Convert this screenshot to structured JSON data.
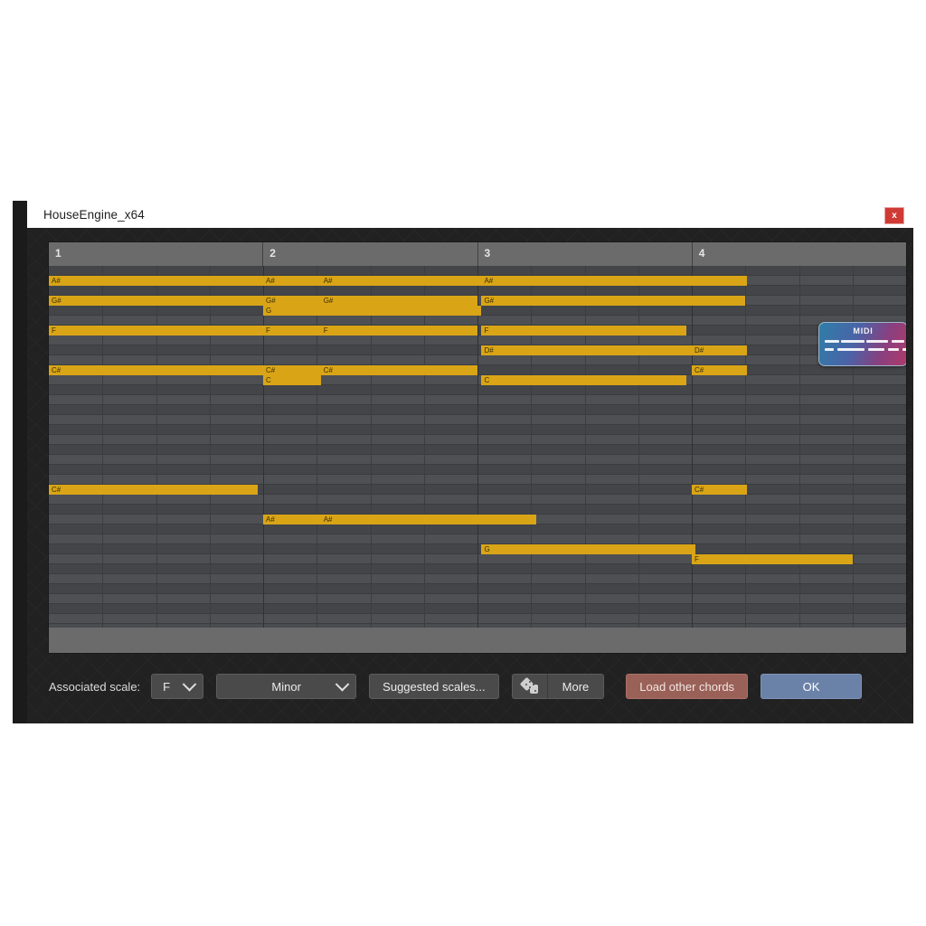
{
  "window": {
    "title": "HouseEngine_x64",
    "close_label": "x"
  },
  "ruler": {
    "bars": [
      "1",
      "2",
      "3",
      "4"
    ]
  },
  "midi_badge": {
    "label": "MIDI"
  },
  "toolbar": {
    "scale_label": "Associated scale:",
    "key_value": "F",
    "mode_value": "Minor",
    "suggested_label": "Suggested scales...",
    "dice_icon": "dice-icon",
    "more_label": "More",
    "load_label": "Load other chords",
    "ok_label": "OK"
  },
  "colors": {
    "note": "#d9a517",
    "accent_ok": "#6b82a8",
    "accent_load": "#9a6158",
    "close": "#cf3a35",
    "grid_dark": "#434549",
    "grid_light": "#4e5054"
  },
  "piano_roll": {
    "bars": 4,
    "beats_per_bar": 4,
    "row_count": 36,
    "notes": [
      {
        "label": "A#",
        "row": 1,
        "start": 0.0,
        "len": 8.0
      },
      {
        "label": "A#",
        "row": 1,
        "start": 8.0,
        "len": 2.15
      },
      {
        "label": "A#",
        "row": 1,
        "start": 10.15,
        "len": 6.0
      },
      {
        "label": "A#",
        "row": 1,
        "start": 16.15,
        "len": 9.9
      },
      {
        "label": "G#",
        "row": 3,
        "start": 0.0,
        "len": 8.0
      },
      {
        "label": "G#",
        "row": 3,
        "start": 8.0,
        "len": 2.15
      },
      {
        "label": "G#",
        "row": 3,
        "start": 10.15,
        "len": 5.85
      },
      {
        "label": "G#",
        "row": 3,
        "start": 16.15,
        "len": 9.85
      },
      {
        "label": "G",
        "row": 4,
        "start": 8.0,
        "len": 8.15
      },
      {
        "label": "F",
        "row": 6,
        "start": 0.0,
        "len": 8.0
      },
      {
        "label": "F",
        "row": 6,
        "start": 8.0,
        "len": 2.15
      },
      {
        "label": "F",
        "row": 6,
        "start": 10.15,
        "len": 5.85
      },
      {
        "label": "F",
        "row": 6,
        "start": 16.15,
        "len": 7.65
      },
      {
        "label": "D#",
        "row": 8,
        "start": 16.15,
        "len": 7.85
      },
      {
        "label": "D#",
        "row": 8,
        "start": 24.0,
        "len": 2.05
      },
      {
        "label": "C#",
        "row": 10,
        "start": 0.0,
        "len": 8.0
      },
      {
        "label": "C#",
        "row": 10,
        "start": 8.0,
        "len": 2.15
      },
      {
        "label": "C#",
        "row": 10,
        "start": 10.15,
        "len": 5.85
      },
      {
        "label": "C#",
        "row": 10,
        "start": 24.0,
        "len": 2.05
      },
      {
        "label": "C",
        "row": 11,
        "start": 8.0,
        "len": 2.15
      },
      {
        "label": "C",
        "row": 11,
        "start": 16.15,
        "len": 7.65
      },
      {
        "label": "C#",
        "row": 22,
        "start": 0.0,
        "len": 7.8
      },
      {
        "label": "C#",
        "row": 22,
        "start": 24.0,
        "len": 2.05
      },
      {
        "label": "A#",
        "row": 25,
        "start": 8.0,
        "len": 2.15
      },
      {
        "label": "A#",
        "row": 25,
        "start": 10.15,
        "len": 8.05
      },
      {
        "label": "G",
        "row": 28,
        "start": 16.15,
        "len": 8.0
      },
      {
        "label": "F",
        "row": 29,
        "start": 24.0,
        "len": 6.0
      }
    ]
  }
}
